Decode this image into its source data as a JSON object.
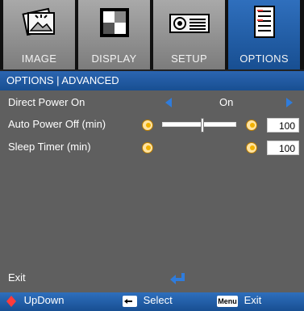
{
  "tabs": [
    {
      "label": "IMAGE",
      "icon": "image-icon"
    },
    {
      "label": "DISPLAY",
      "icon": "display-icon"
    },
    {
      "label": "SETUP",
      "icon": "setup-icon"
    },
    {
      "label": "OPTIONS",
      "icon": "options-icon",
      "active": true
    }
  ],
  "header": {
    "title": "OPTIONS | ADVANCED"
  },
  "rows": {
    "direct_power_on": {
      "label": "Direct Power On",
      "value": "On"
    },
    "auto_power_off": {
      "label": "Auto Power Off (min)",
      "value": "100",
      "slider_fraction": 0.55
    },
    "sleep_timer": {
      "label": "Sleep Timer (min)",
      "value": "100"
    },
    "exit": {
      "label": "Exit"
    }
  },
  "footer": {
    "updown": "UpDown",
    "select": "Select",
    "menu_key": "Menu",
    "exit": "Exit"
  },
  "colors": {
    "accent": "#2f7cdc",
    "header": "#1f5aa6",
    "body": "#5f5f5f"
  }
}
